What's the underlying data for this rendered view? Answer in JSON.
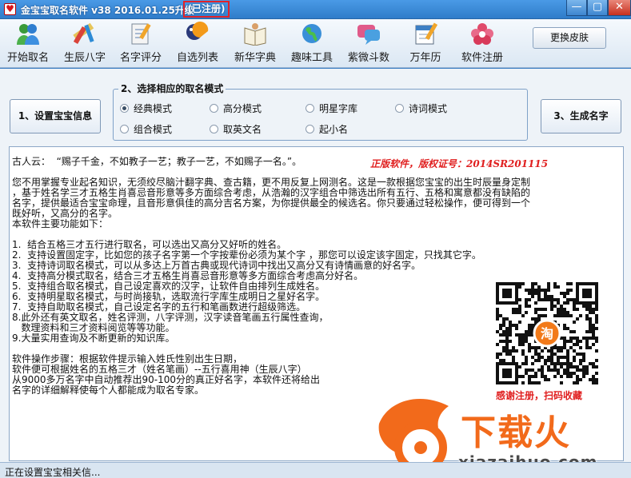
{
  "window": {
    "title": "金宝宝取名软件 v38  2016.01.25升级",
    "badge": "(已注册)",
    "min": "—",
    "max": "▢",
    "close": "✕"
  },
  "toolbar": {
    "items": [
      {
        "label": "开始取名",
        "icon": "people-icon"
      },
      {
        "label": "生辰八字",
        "icon": "pencil-ruler-icon"
      },
      {
        "label": "名字评分",
        "icon": "notepad-icon"
      },
      {
        "label": "自选列表",
        "icon": "pac-man-list-icon"
      },
      {
        "label": "新华字典",
        "icon": "book-reader-icon"
      },
      {
        "label": "趣味工具",
        "icon": "globe-icon"
      },
      {
        "label": "紫微斗数",
        "icon": "chat-bubble-icon"
      },
      {
        "label": "万年历",
        "icon": "calendar-icon"
      },
      {
        "label": "软件注册",
        "icon": "flower-icon"
      }
    ],
    "skin_button": "更换皮肤"
  },
  "main": {
    "set_info_button": "1、设置宝宝信息",
    "generate_button": "3、生成名字",
    "mode_group_title": "2、选择相应的取名模式",
    "modes": [
      {
        "label": "经典模式",
        "checked": true
      },
      {
        "label": "高分模式",
        "checked": false
      },
      {
        "label": "明星字库",
        "checked": false
      },
      {
        "label": "诗词模式",
        "checked": false
      },
      {
        "label": "组合模式",
        "checked": false
      },
      {
        "label": "取英文名",
        "checked": false
      },
      {
        "label": "起小名",
        "checked": false
      }
    ],
    "text_lines": [
      "古人云：  “赐子千金，不如教子一艺；教子一艺，不如赐子一名。”。",
      "",
      "您不用掌握专业起名知识，无须绞尽脑汁翻字典、查古籍，更不用反复上网测名。这是一款根据您宝宝的出生时辰量身定制",
      "，基于姓名学三才五格生肖喜忌音形意等多方面综合考虑，从浩瀚的汉字组合中筛选出所有五行、五格和寓意都没有缺陷的",
      "名字，提供最适合宝宝命理，且音形意俱佳的高分吉名方案，为你提供最全的候选名。你只要通过轻松操作，便可得到一个",
      "既好听，又高分的名字。",
      "本软件主要功能如下：",
      "",
      "1.  结合五格三才五行进行取名，可以选出又高分又好听的姓名。",
      "2.  支持设置固定字，比如您的孩子名字第一个字按辈份必须为某个字 ，那您可以设定该字固定，只找其它字。",
      "3.  支持诗词取名模式，可以从多达上万首古典或现代诗词中找出又高分又有诗情画意的好名字。",
      "4.  支持高分模式取名，结合三才五格生肖喜忌音形意等多方面综合考虑高分好名。",
      "5.  支持组合取名模式，自己设定喜欢的汉字，让软件自由排列生成姓名。",
      "6.  支持明星取名模式，与时尚接轨，选取流行字库生成明日之星好名字。",
      "7.  支持自助取名模式，自己设定名字的五行和笔画数进行超级筛选。",
      "8.此外还有英文取名，姓名评测，八字评测，汉字读音笔画五行属性查询，",
      "   数理资料和三才资料阅览等等功能。",
      "9.大量实用查询及不断更新的知识库。",
      "",
      "软件操作步骤：根据软件提示输入姓氏性别出生日期，",
      "软件便可根据姓名的五格三才（姓名笔画）--五行喜用神（生辰八字）",
      "从9000多万名字中自动推荐出90-100分的真正好名字，本软件还将给出",
      "名字的详细解释使每个人都能成为取名专家。"
    ],
    "copyright": "正版软件，版权证号：2014SR201115",
    "qr_caption": "感谢注册，扫码收藏"
  },
  "watermark": {
    "text": "下载火",
    "url": "xiazaihuo.com"
  },
  "status": {
    "text": "正在设置宝宝相关信..."
  },
  "colors": {
    "titlebar": "#3a88d6",
    "accent_red": "#e01f1f",
    "watermark_orange": "#f26a1b"
  }
}
